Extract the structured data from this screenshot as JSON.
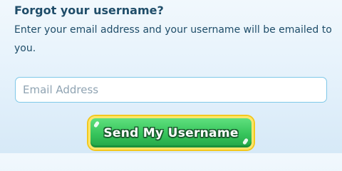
{
  "form": {
    "title": "Forgot your username?",
    "description": "Enter your email address and your username will be emailed to you.",
    "email_placeholder": "Email Address",
    "email_value": "",
    "submit_label": "Send My Username"
  },
  "colors": {
    "text": "#1f4d69",
    "input_border": "#7fc8e8",
    "button_green": "#36c45b",
    "button_border": "#ffe66a",
    "background": "#e4f1fb"
  }
}
